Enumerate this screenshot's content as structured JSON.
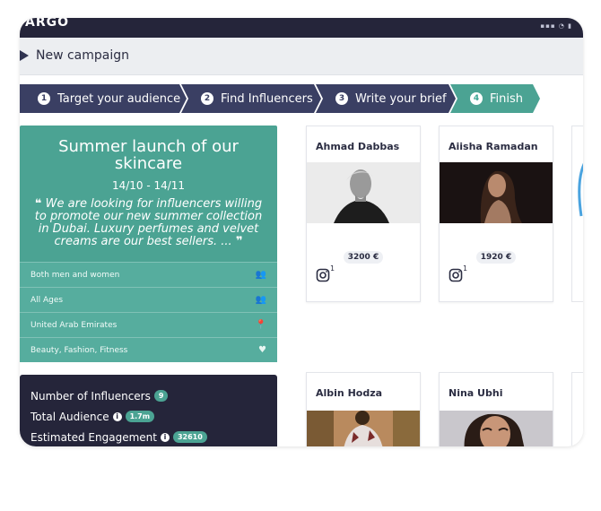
{
  "app": {
    "brand": "ARGO",
    "status": "▪▪▪ ◔ ▮"
  },
  "header": {
    "title": "New campaign"
  },
  "steps": [
    {
      "num": "1",
      "label": "Target your audience"
    },
    {
      "num": "2",
      "label": "Find Influencers"
    },
    {
      "num": "3",
      "label": "Write your brief"
    },
    {
      "num": "4",
      "label": "Finish"
    }
  ],
  "colors": {
    "dark": "#25253a",
    "teal": "#4ba393",
    "step": "#3a3f63",
    "step_active": "#4ba393"
  },
  "campaign": {
    "title": "Summer launch of our skincare",
    "dates": "14/10 - 14/11",
    "quote_open": "❝",
    "quote": "We are looking for influencers willing to promote our new summer collection in Dubai. Luxury perfumes and velvet creams are our best sellers. ...",
    "quote_close": "❞",
    "criteria": [
      {
        "label": "Both men and women",
        "icon": "users-icon",
        "glyph": "👥"
      },
      {
        "label": "All Ages",
        "icon": "users-icon",
        "glyph": "👥"
      },
      {
        "label": "United Arab Emirates",
        "icon": "location-pin-icon",
        "glyph": "📍"
      },
      {
        "label": "Beauty, Fashion, Fitness",
        "icon": "heart-icon",
        "glyph": "♥"
      }
    ]
  },
  "stats": {
    "influencers_label": "Number of Influencers",
    "influencers_value": "9",
    "audience_label": "Total Audience",
    "audience_value": "1.7m",
    "engagement_label": "Estimated Engagement",
    "engagement_value": "32610",
    "info_glyph": "i"
  },
  "influencers": [
    {
      "name": "Ahmad Dabbas",
      "price": "3200 €",
      "instagram_count": "1"
    },
    {
      "name": "Aiisha Ramadan",
      "price": "1920 €",
      "instagram_count": "1"
    },
    {
      "name": "Albin Hodza"
    },
    {
      "name": "Nina Ubhi"
    }
  ]
}
